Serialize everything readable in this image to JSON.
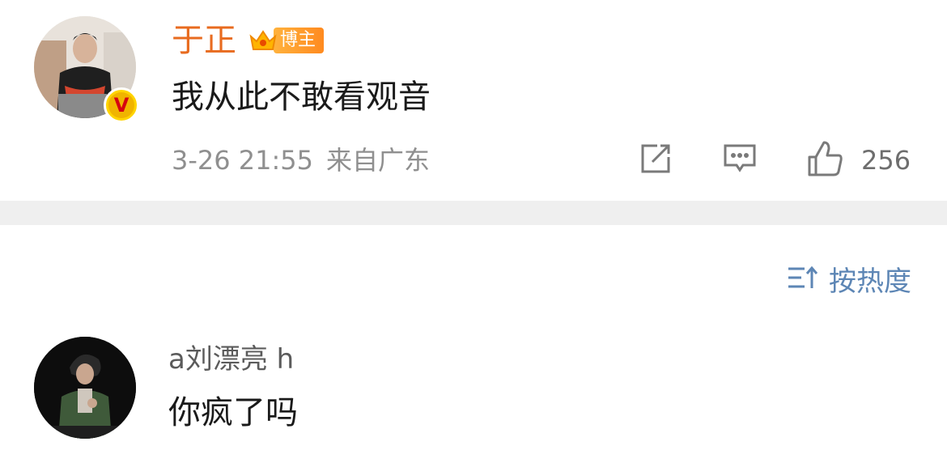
{
  "post": {
    "username": "于正",
    "badge_label": "博主",
    "text": "我从此不敢看观音",
    "date": "3-26 21:55",
    "source": "来自广东",
    "like_count": "256",
    "icons": [
      "verified-v-icon",
      "crown-icon",
      "share-icon",
      "comment-icon",
      "like-icon"
    ]
  },
  "sort": {
    "label": "按热度",
    "icon": "sort-icon"
  },
  "comment": {
    "username": "a刘漂亮 h",
    "text": "你疯了吗"
  },
  "colors": {
    "username_orange": "#e86b1f",
    "badge_orange": "#ff9a2a",
    "verified_yellow": "#ffd400",
    "sort_blue": "#5d86b5",
    "meta_gray": "#8f8f8f",
    "divider_gray": "#efefef"
  }
}
